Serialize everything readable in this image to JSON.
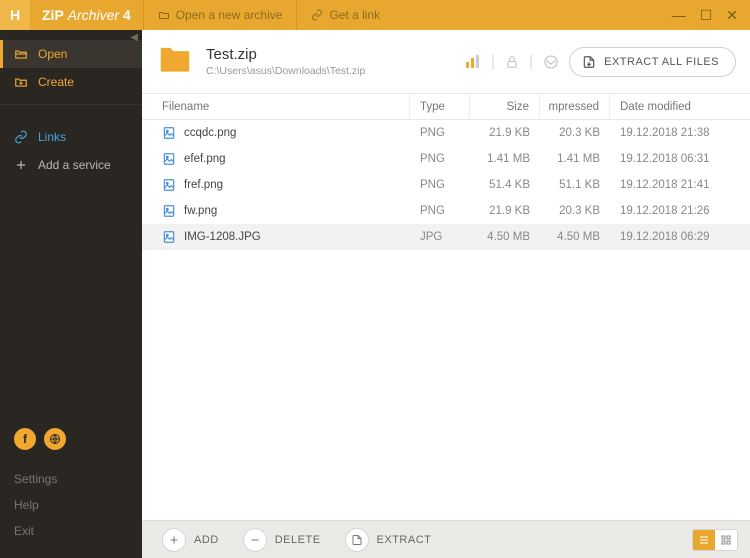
{
  "app": {
    "logo": "H",
    "name_bold": "ZiP",
    "name_light": "Archiver",
    "version": "4"
  },
  "titlebar": {
    "open_archive": "Open a new archive",
    "get_link": "Get a link"
  },
  "sidebar": {
    "open": "Open",
    "create": "Create",
    "links": "Links",
    "add_service": "Add a service",
    "settings": "Settings",
    "help": "Help",
    "exit": "Exit"
  },
  "archive": {
    "title": "Test.zip",
    "path": "C:\\Users\\asus\\Downloads\\Test.zip"
  },
  "header_actions": {
    "extract_all": "EXTRACT ALL FILES"
  },
  "columns": {
    "filename": "Filename",
    "type": "Type",
    "size": "Size",
    "compressed": "mpressed",
    "date": "Date modified"
  },
  "files": [
    {
      "name": "ccqdc.png",
      "type": "PNG",
      "size": "21.9 KB",
      "compressed": "20.3 KB",
      "date": "19.12.2018 21:38",
      "selected": false
    },
    {
      "name": "efef.png",
      "type": "PNG",
      "size": "1.41 MB",
      "compressed": "1.41 MB",
      "date": "19.12.2018 06:31",
      "selected": false
    },
    {
      "name": "fref.png",
      "type": "PNG",
      "size": "51.4 KB",
      "compressed": "51.1 KB",
      "date": "19.12.2018 21:41",
      "selected": false
    },
    {
      "name": "fw.png",
      "type": "PNG",
      "size": "21.9 KB",
      "compressed": "20.3 KB",
      "date": "19.12.2018 21:26",
      "selected": false
    },
    {
      "name": "IMG-1208.JPG",
      "type": "JPG",
      "size": "4.50 MB",
      "compressed": "4.50 MB",
      "date": "19.12.2018 06:29",
      "selected": true
    }
  ],
  "bottombar": {
    "add": "ADD",
    "delete": "DELETE",
    "extract": "EXTRACT"
  }
}
